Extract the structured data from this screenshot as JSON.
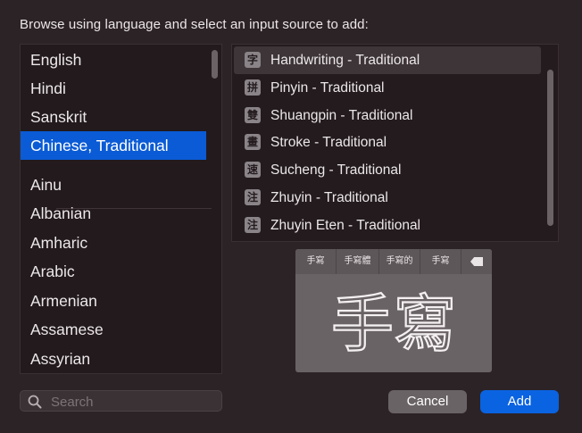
{
  "header": {
    "prompt": "Browse using language and select an input source to add:"
  },
  "languages": {
    "pinned": [
      "English",
      "Hindi",
      "Sanskrit",
      "Chinese, Traditional"
    ],
    "selected": "Chinese, Traditional",
    "all": [
      "Ainu",
      "Albanian",
      "Amharic",
      "Arabic",
      "Armenian",
      "Assamese",
      "Assyrian"
    ]
  },
  "sources": {
    "items": [
      {
        "icon": "字",
        "label": "Handwriting - Traditional"
      },
      {
        "icon": "拼",
        "label": "Pinyin - Traditional"
      },
      {
        "icon": "雙",
        "label": "Shuangpin - Traditional"
      },
      {
        "icon": "畫",
        "label": "Stroke - Traditional"
      },
      {
        "icon": "速",
        "label": "Sucheng - Traditional"
      },
      {
        "icon": "注",
        "label": "Zhuyin - Traditional"
      },
      {
        "icon": "注",
        "label": "Zhuyin Eten - Traditional"
      }
    ],
    "selected": "Handwriting - Traditional"
  },
  "preview": {
    "candidates": [
      "手寫",
      "手寫體",
      "手寫的",
      "手寫"
    ],
    "handwritten_text": "手寫",
    "delete_icon": "delete-backward-icon"
  },
  "search": {
    "placeholder": "Search",
    "value": ""
  },
  "buttons": {
    "cancel": "Cancel",
    "add": "Add"
  },
  "colors": {
    "accent": "#0a5bd5",
    "add_button": "#0a63e0",
    "background": "#2c2326"
  }
}
